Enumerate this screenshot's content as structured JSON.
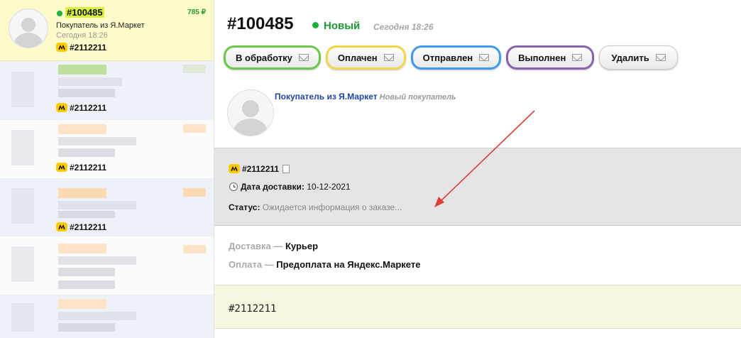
{
  "sidebar": {
    "active_item": {
      "number": "#100485",
      "price": "785 ₽",
      "buyer": "Покупатель из Я.Маркет",
      "time": "Сегодня 18:26",
      "external_id": "#2112211"
    },
    "other_items": [
      {
        "external_id": "#2112211"
      },
      {
        "external_id": "#2112211"
      },
      {
        "external_id": "#2112211"
      }
    ]
  },
  "order": {
    "number": "#100485",
    "status": "Новый",
    "status_color": "#1a9a33",
    "time": "Сегодня 18:26",
    "buttons": [
      {
        "label": "В обработку",
        "accent": "#6ac94a"
      },
      {
        "label": "Оплачен",
        "accent": "#f2d64a"
      },
      {
        "label": "Отправлен",
        "accent": "#3d9aec"
      },
      {
        "label": "Выполнен",
        "accent": "#8a62b0"
      },
      {
        "label": "Удалить",
        "accent": "#c9c9c9"
      }
    ],
    "customer": {
      "name": "Покупатель из Я.Маркет",
      "tag": "Новый покупатель"
    },
    "market": {
      "external_id": "#2112211",
      "delivery_date_label": "Дата доставки:",
      "delivery_date": "10-12-2021",
      "status_label": "Статус:",
      "status_value": "Ожидается информация о заказе..."
    },
    "delivery": {
      "label": "Доставка —",
      "value": "Курьер"
    },
    "payment": {
      "label": "Оплата —",
      "value": "Предоплата на Яндекс.Маркете"
    },
    "note": "#2112211"
  },
  "annotation_color": "#d9403a"
}
